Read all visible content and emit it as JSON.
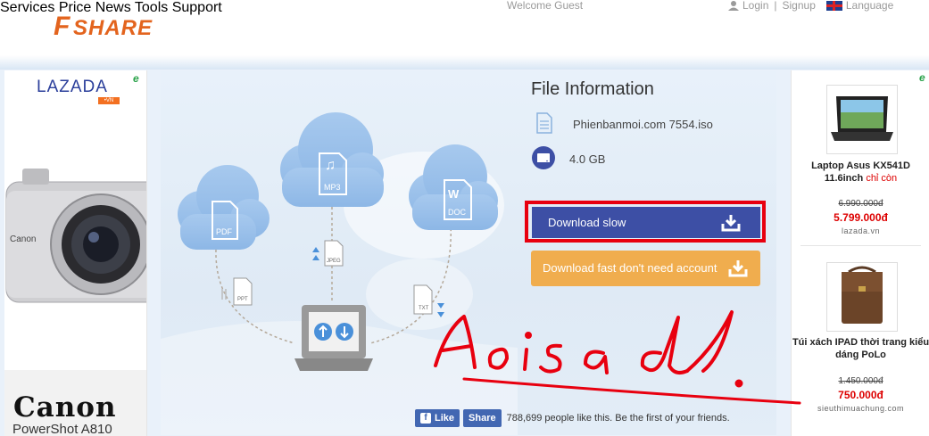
{
  "header": {
    "logo_text": "FSHARE",
    "welcome": "Welcome Guest",
    "login": "Login",
    "signup": "Signup",
    "language": "Language",
    "nav": [
      "Services",
      "Price",
      "News",
      "Tools",
      "Support"
    ]
  },
  "ad_left": {
    "brand": "LAZADA",
    "brand_suffix": "•VN",
    "camera_brand": "Canon",
    "camera_model": "PowerShot A810"
  },
  "file_info": {
    "title": "File Information",
    "file_name": "Phienbanmoi.com 7554.iso",
    "file_size": "4.0 GB",
    "download_slow": "Download slow",
    "download_fast": "Download fast don't need account"
  },
  "illustration": {
    "labels": [
      "PDF",
      "MP3",
      "DOC",
      "JPEG",
      "PPT",
      "TXT"
    ]
  },
  "facebook": {
    "like": "Like",
    "share": "Share",
    "text": "788,699 people like this. Be the first of your friends."
  },
  "ad_right": {
    "products": [
      {
        "name": "Laptop Asus KX541D 11.6inch",
        "suffix": "chỉ còn",
        "old_price": "6.990.000đ",
        "new_price": "5.799.000đ",
        "source": "lazada.vn"
      },
      {
        "name": "Túi xách IPAD thời trang kiểu dáng PoLo",
        "suffix": "",
        "old_price": "1.450.000đ",
        "new_price": "750.000đ",
        "source": "sieuthimuachung.com"
      }
    ]
  },
  "annotation": {
    "handwritten_text": "Aoisa d."
  },
  "colors": {
    "nav": "#2c5f9e",
    "download_slow_bg": "#3d4fa5",
    "download_fast_bg": "#f0ad4e",
    "highlight_box": "#e8000f",
    "price_red": "#dd0000",
    "facebook_blue": "#4267b2"
  }
}
